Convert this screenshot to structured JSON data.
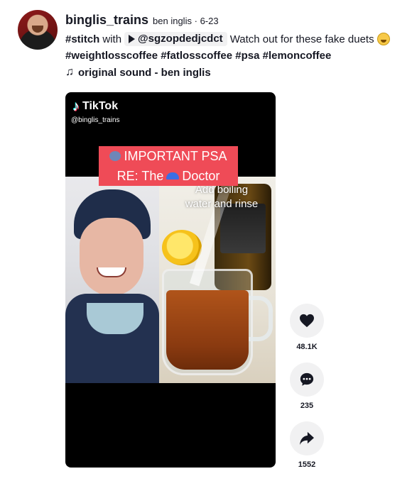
{
  "author": {
    "username": "binglis_trains",
    "display_name": "ben inglis",
    "separator": "·",
    "date": "6-23"
  },
  "caption": {
    "stitch_tag": "#stitch",
    "with_word": "with",
    "mention": "@sgzopdedjcdct",
    "text": "Watch out for these fake duets",
    "hashtags": "#weightlosscoffee #fatlosscoffee #psa #lemoncoffee"
  },
  "music": {
    "icon": "music-note-icon",
    "label": "original sound - ben inglis"
  },
  "video": {
    "watermark": "TikTok",
    "handle": "@binglis_trains",
    "banner_line1": "IMPORTANT PSA",
    "banner_line2_prefix": "RE: The",
    "banner_line2_suffix": "Doctor",
    "overlay_line1": "Add boiling",
    "overlay_line2": "water and rinse",
    "banner_color": "#ef4b57"
  },
  "actions": {
    "likes": "48.1K",
    "comments": "235",
    "shares": "1552"
  }
}
